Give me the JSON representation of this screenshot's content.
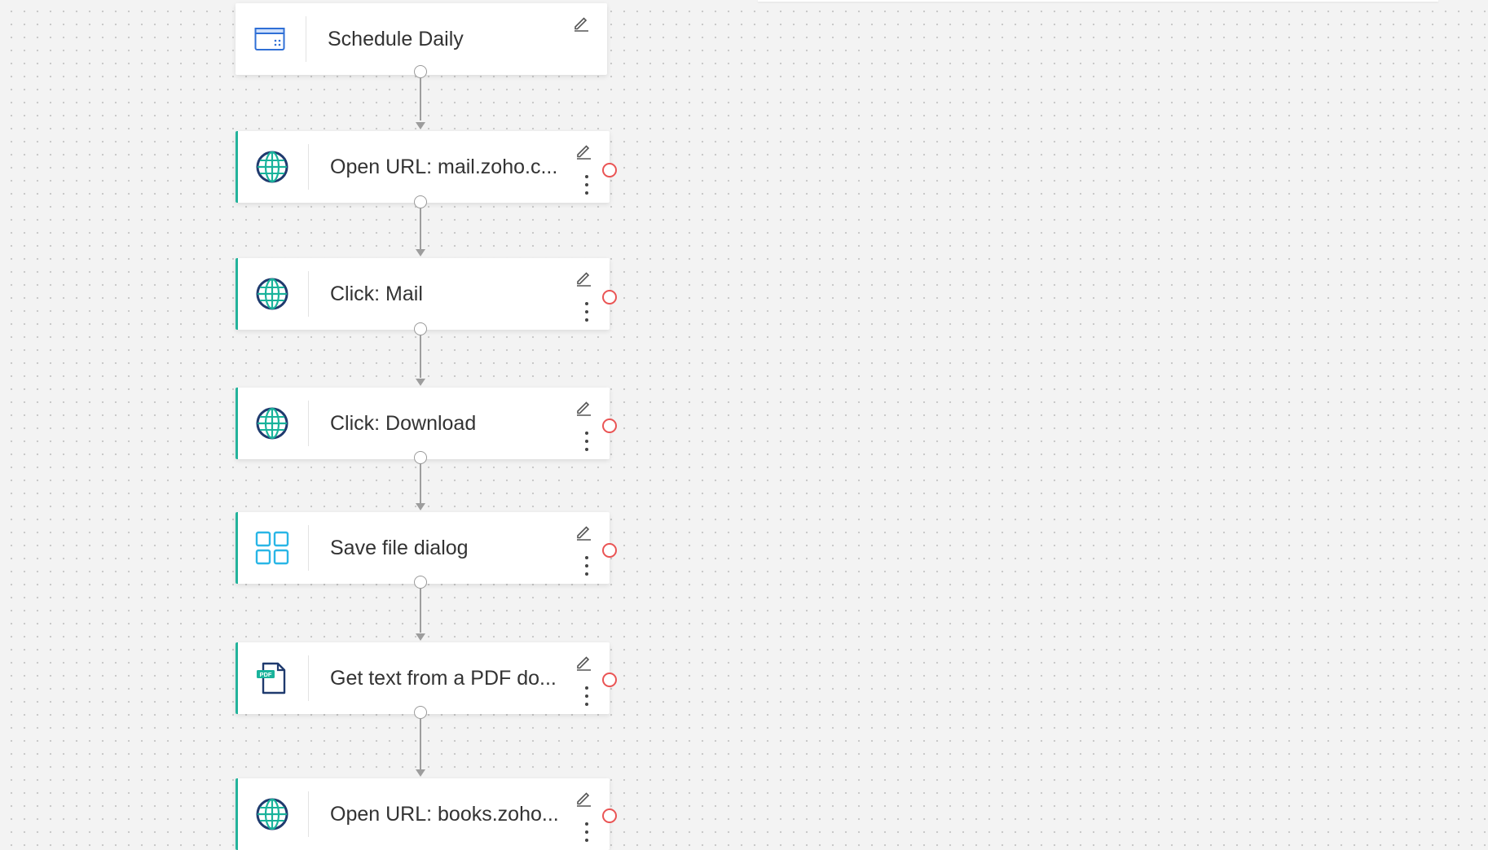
{
  "colors": {
    "accent": "#23b39b",
    "error_port": "#ea5454",
    "connector": "#9d9d9d"
  },
  "flow": {
    "trigger": {
      "label": "Schedule Daily",
      "icon": "calendar-icon"
    },
    "steps": [
      {
        "label": "Open URL: mail.zoho.c...",
        "icon": "globe-icon"
      },
      {
        "label": "Click: Mail",
        "icon": "globe-icon"
      },
      {
        "label": "Click: Download",
        "icon": "globe-icon"
      },
      {
        "label": "Save file dialog",
        "icon": "grid-icon"
      },
      {
        "label": "Get text from a PDF do...",
        "icon": "pdf-file-icon",
        "icon_text": "PDF"
      },
      {
        "label": "Open URL: books.zoho...",
        "icon": "globe-icon"
      }
    ]
  }
}
